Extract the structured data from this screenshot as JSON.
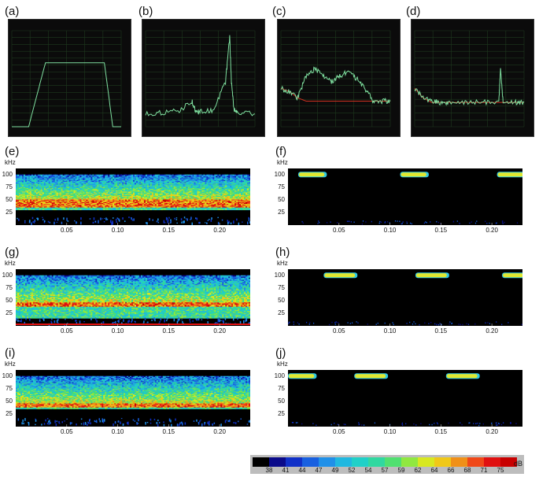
{
  "panels": {
    "a": {
      "label": "(a)"
    },
    "b": {
      "label": "(b)"
    },
    "c": {
      "label": "(c)"
    },
    "d": {
      "label": "(d)"
    },
    "e": {
      "label": "(e)"
    },
    "f": {
      "label": "(f)"
    },
    "g": {
      "label": "(g)"
    },
    "h": {
      "label": "(h)"
    },
    "i": {
      "label": "(i)"
    },
    "j": {
      "label": "(j)"
    }
  },
  "spectrogram_axes": {
    "y_unit": "kHz",
    "y_ticks": [
      "100",
      "75",
      "50",
      "25"
    ],
    "x_ticks": [
      "0.05",
      "0.10",
      "0.15",
      "0.20"
    ]
  },
  "colorbar": {
    "unit": "dB",
    "values": [
      "38",
      "41",
      "44",
      "47",
      "49",
      "52",
      "54",
      "57",
      "59",
      "62",
      "64",
      "66",
      "68",
      "71",
      "75"
    ],
    "colors": [
      "#000000",
      "#0a0a8a",
      "#1030c8",
      "#1860e0",
      "#2090e8",
      "#20b8e0",
      "#20d0c8",
      "#30d8a0",
      "#50e070",
      "#90e840",
      "#d8e820",
      "#f0c818",
      "#f09018",
      "#f04818",
      "#e01010",
      "#c80000"
    ]
  },
  "chart_data": [
    {
      "panel": "a",
      "type": "line",
      "description_series": "flat-top band spectrum",
      "x": [
        0,
        20,
        30,
        40,
        50,
        60,
        70,
        80,
        90,
        100,
        110,
        120,
        130
      ],
      "y": [
        -140,
        -140,
        -90,
        -40,
        -40,
        -40,
        -40,
        -40,
        -40,
        -40,
        -40,
        -140,
        -140
      ],
      "xlim": [
        0,
        130
      ],
      "ylim": [
        -140,
        10
      ]
    },
    {
      "panel": "b",
      "type": "line",
      "x": [
        0,
        20,
        40,
        55,
        60,
        65,
        80,
        95,
        100,
        102,
        105,
        110,
        130
      ],
      "y": [
        -120,
        -118,
        -115,
        -100,
        -118,
        -116,
        -115,
        -70,
        0,
        -70,
        -112,
        -118,
        -120
      ],
      "xlim": [
        0,
        130
      ],
      "ylim": [
        -140,
        10
      ]
    },
    {
      "panel": "c",
      "type": "line",
      "x": [
        0,
        10,
        20,
        30,
        40,
        50,
        60,
        70,
        80,
        90,
        100,
        110,
        120,
        130
      ],
      "y": [
        -80,
        -85,
        -95,
        -60,
        -50,
        -60,
        -70,
        -60,
        -55,
        -65,
        -80,
        -100,
        -100,
        -100
      ],
      "xlim": [
        0,
        130
      ],
      "ylim": [
        -140,
        10
      ]
    },
    {
      "panel": "d",
      "type": "line",
      "x": [
        0,
        10,
        20,
        30,
        40,
        60,
        80,
        100,
        102,
        105,
        120,
        130
      ],
      "y": [
        -80,
        -95,
        -100,
        -102,
        -103,
        -102,
        -102,
        -100,
        -50,
        -100,
        -102,
        -102
      ],
      "xlim": [
        0,
        130
      ],
      "ylim": [
        -140,
        10
      ]
    },
    {
      "panel": "e",
      "type": "heatmap",
      "pattern": "continuous broadband",
      "band_khz": [
        30,
        100
      ],
      "peak_khz": [
        35,
        50
      ],
      "xlim": [
        0,
        0.23
      ]
    },
    {
      "panel": "f",
      "type": "heatmap",
      "pattern": "pulses",
      "freq_khz": 100,
      "pulses_s": [
        [
          0.01,
          0.035
        ],
        [
          0.11,
          0.135
        ],
        [
          0.205,
          0.23
        ]
      ],
      "xlim": [
        0,
        0.23
      ]
    },
    {
      "panel": "g",
      "type": "heatmap",
      "pattern": "continuous broadband",
      "band_khz": [
        15,
        100
      ],
      "peak_khz": [
        38,
        45
      ],
      "xlim": [
        0,
        0.23
      ]
    },
    {
      "panel": "h",
      "type": "heatmap",
      "pattern": "pulses",
      "freq_khz": 100,
      "pulses_s": [
        [
          0.035,
          0.065
        ],
        [
          0.125,
          0.155
        ],
        [
          0.21,
          0.23
        ]
      ],
      "xlim": [
        0,
        0.23
      ]
    },
    {
      "panel": "i",
      "type": "heatmap",
      "pattern": "continuous broadband",
      "band_khz": [
        35,
        100
      ],
      "peak_khz": [
        37,
        45
      ],
      "xlim": [
        0,
        0.23
      ]
    },
    {
      "panel": "j",
      "type": "heatmap",
      "pattern": "pulses",
      "freq_khz": 100,
      "pulses_s": [
        [
          0.0,
          0.025
        ],
        [
          0.065,
          0.095
        ],
        [
          0.155,
          0.185
        ]
      ],
      "xlim": [
        0,
        0.23
      ]
    }
  ]
}
